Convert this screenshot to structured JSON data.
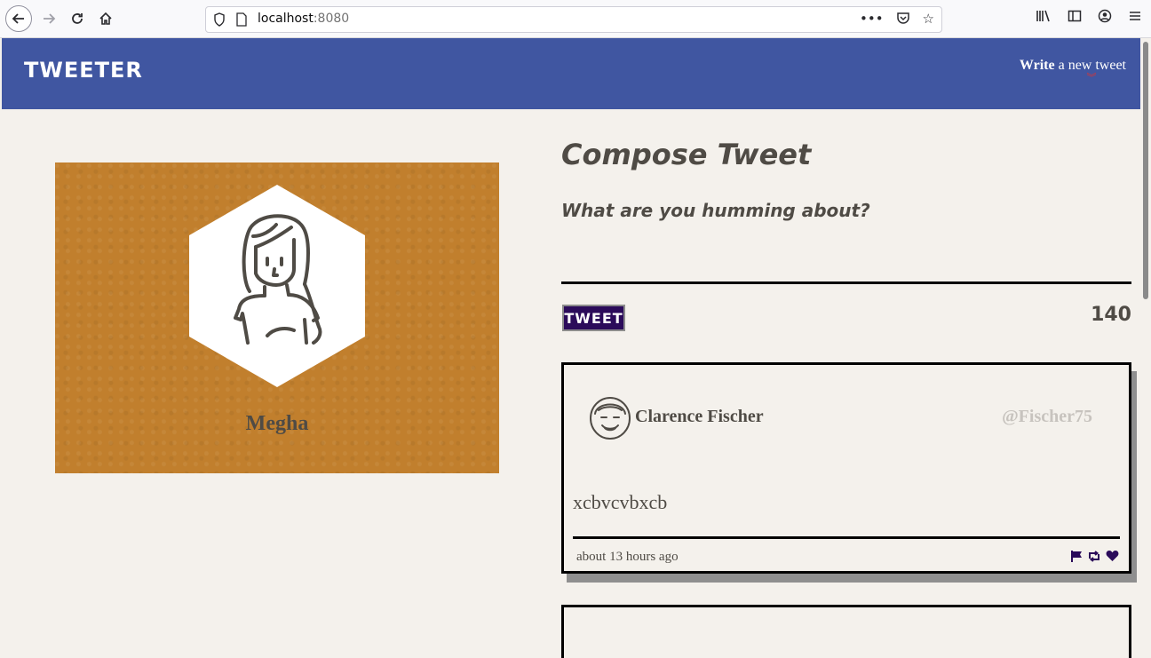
{
  "browser": {
    "url_host": "localhost",
    "url_port": ":8080"
  },
  "header": {
    "brand": "TWEETER",
    "write_strong": "Write",
    "write_rest": " a new tweet",
    "accent_color": "#4056a1"
  },
  "profile": {
    "name": "Megha",
    "background_color": "#c17f2d"
  },
  "compose": {
    "title": "Compose Tweet",
    "prompt": "What are you humming about?",
    "input_value": "",
    "button_label": "TWEET",
    "counter": "140"
  },
  "tweets": [
    {
      "name": "Clarence Fischer",
      "handle": "@Fischer75",
      "content": "xcbvcvbxcb",
      "time": "about 13 hours ago",
      "actions": [
        "flag-icon",
        "retweet-icon",
        "heart-icon"
      ]
    }
  ]
}
